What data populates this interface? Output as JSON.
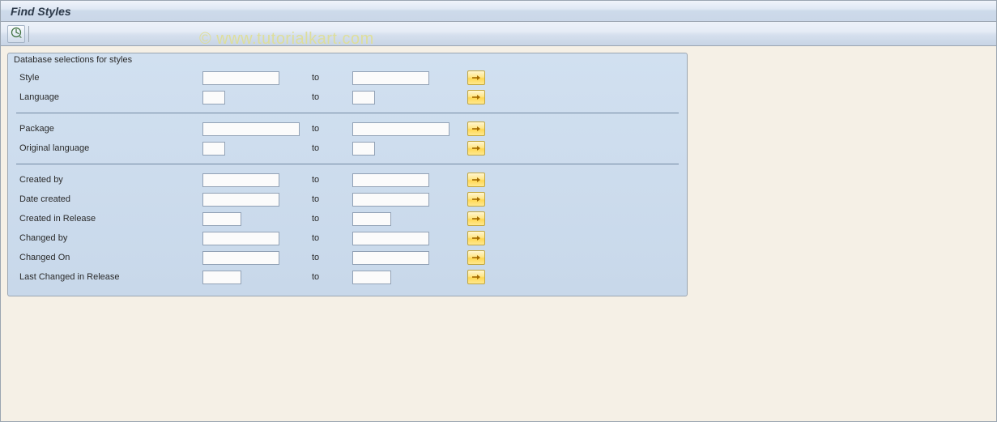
{
  "window": {
    "title": "Find Styles"
  },
  "watermark": "© www.tutorialkart.com",
  "panel": {
    "title": "Database selections for styles",
    "to_label": "to",
    "sections": [
      [
        {
          "label": "Style",
          "from_width": "long",
          "to_width": "long"
        },
        {
          "label": "Language",
          "from_width": "short",
          "to_width": "short"
        }
      ],
      [
        {
          "label": "Package",
          "from_width": "xl",
          "to_width": "xl"
        },
        {
          "label": "Original language",
          "from_width": "short",
          "to_width": "short"
        }
      ],
      [
        {
          "label": "Created by",
          "from_width": "long",
          "to_width": "long"
        },
        {
          "label": "Date created",
          "from_width": "long",
          "to_width": "long"
        },
        {
          "label": "Created in Release",
          "from_width": "med",
          "to_width": "med"
        },
        {
          "label": "Changed by",
          "from_width": "long",
          "to_width": "long"
        },
        {
          "label": "Changed On",
          "from_width": "long",
          "to_width": "long"
        },
        {
          "label": "Last Changed in Release",
          "from_width": "med",
          "to_width": "med"
        }
      ]
    ]
  }
}
